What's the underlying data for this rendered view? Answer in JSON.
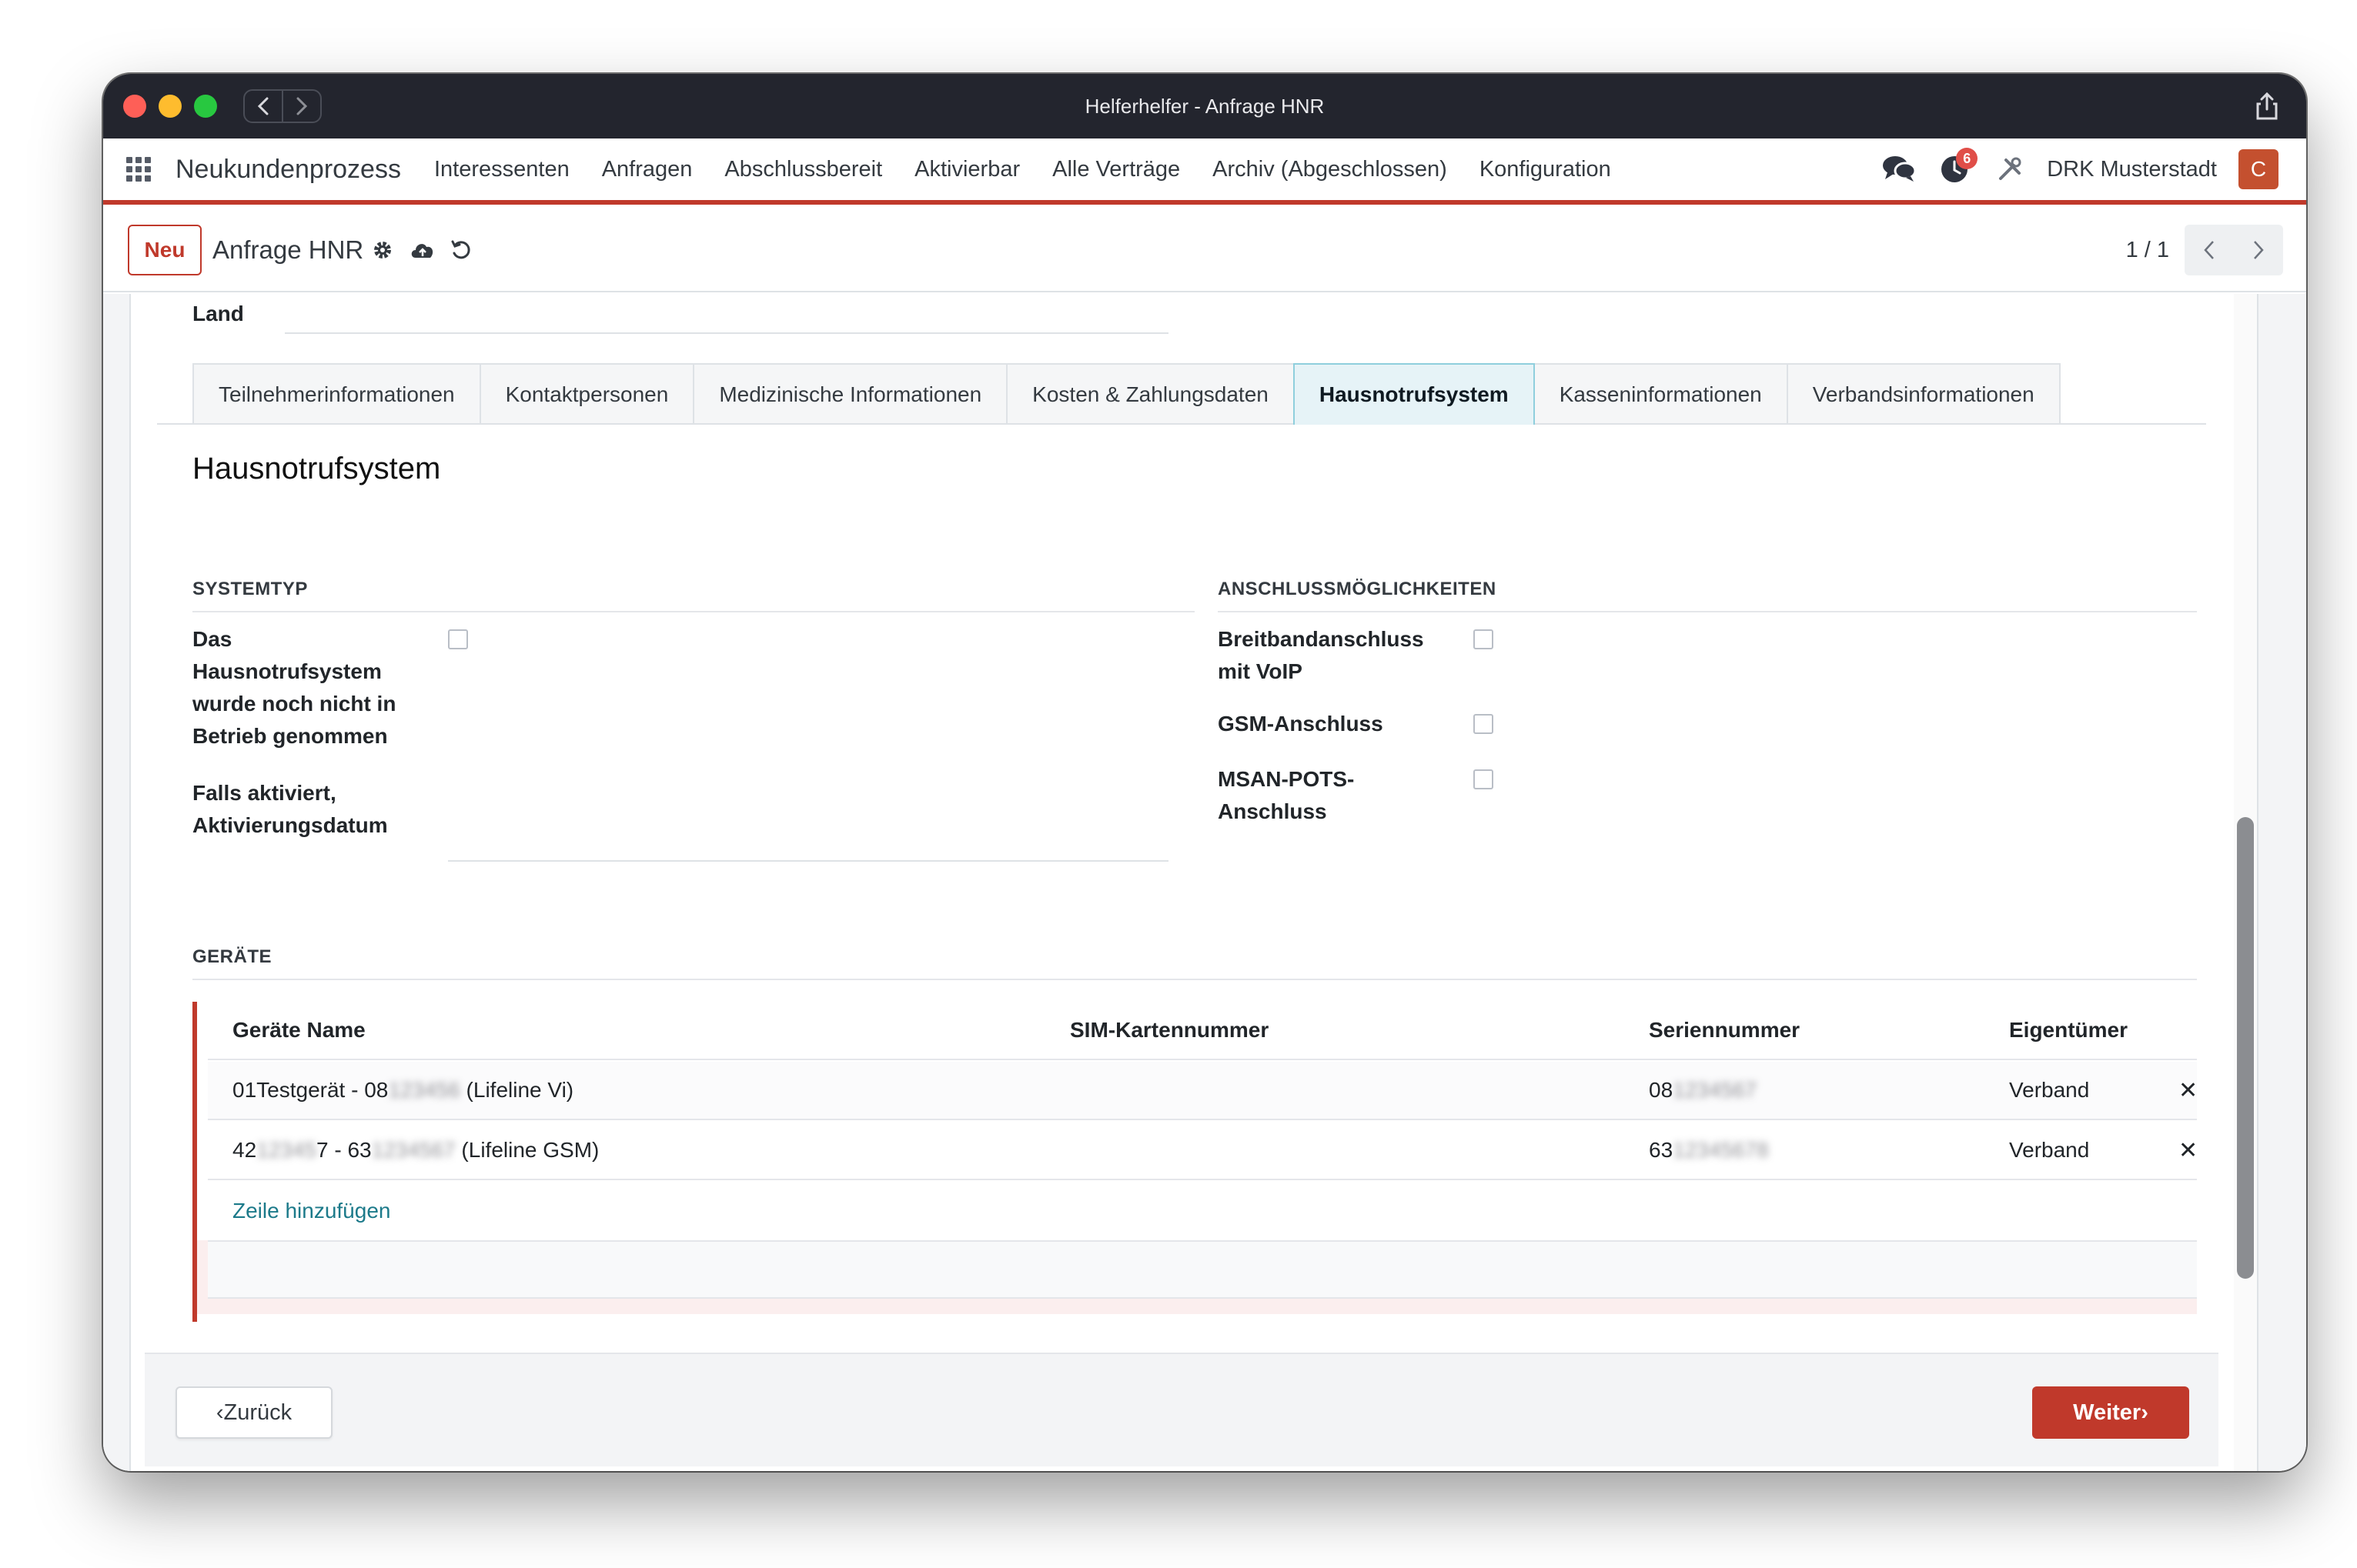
{
  "window": {
    "title": "Helferhelfer - Anfrage HNR"
  },
  "navbar": {
    "brand": "Neukundenprozess",
    "menu": [
      "Interessenten",
      "Anfragen",
      "Abschlussbereit",
      "Aktivierbar",
      "Alle Verträge",
      "Archiv (Abgeschlossen)",
      "Konfiguration"
    ],
    "activity_badge": "6",
    "company": "DRK Musterstadt",
    "avatar_initial": "C"
  },
  "control_panel": {
    "new_button": "Neu",
    "breadcrumb": "Anfrage HNR",
    "pager_value": "1 / 1"
  },
  "form": {
    "land_label": "Land",
    "tabs": [
      "Teilnehmerinformationen",
      "Kontaktpersonen",
      "Medizinische Informationen",
      "Kosten & Zahlungsdaten",
      "Hausnotrufsystem",
      "Kasseninformationen",
      "Verbandsinformationen"
    ],
    "active_tab": "Hausnotrufsystem",
    "section_title": "Hausnotrufsystem",
    "systemtyp": {
      "heading": "SYSTEMTYP",
      "not_in_operation_label": "Das Hausnotrufsystem wurde noch nicht in Betrieb genommen",
      "activation_date_label": "Falls aktiviert, Aktivierungsdatum"
    },
    "anschluss": {
      "heading": "ANSCHLUSSMÖGLICHKEITEN",
      "broadband_label": "Breitbandanschluss mit VoIP",
      "gsm_label": "GSM-Anschluss",
      "msan_label": "MSAN-POTS-Anschluss"
    },
    "devices": {
      "heading": "GERÄTE",
      "columns": [
        "Geräte Name",
        "SIM-Kartennummer",
        "Seriennummer",
        "Eigentümer"
      ],
      "rows": [
        {
          "name_a": "01Testgerät - 08",
          "name_hidden": "123456",
          "name_b": " (Lifeline Vi)",
          "sim": "",
          "serial_a": "08",
          "serial_hidden": "1234567",
          "owner": "Verband"
        },
        {
          "name_a": "42",
          "name_hidden_1": "12345",
          "name_mid": "7 - 63",
          "name_hidden_2": "1234567",
          "name_b": " (Lifeline GSM)",
          "sim": "",
          "serial_a": "63",
          "serial_hidden": "12345678",
          "owner": "Verband"
        }
      ],
      "remove_glyph": "✕",
      "add_line": "Zeile hinzufügen"
    },
    "footer": {
      "back": "‹Zurück",
      "next": "Weiter›"
    }
  },
  "colors": {
    "accent": "#c0392b",
    "link": "#1c7a8a",
    "active_tab_bg": "#e6f3f7"
  }
}
